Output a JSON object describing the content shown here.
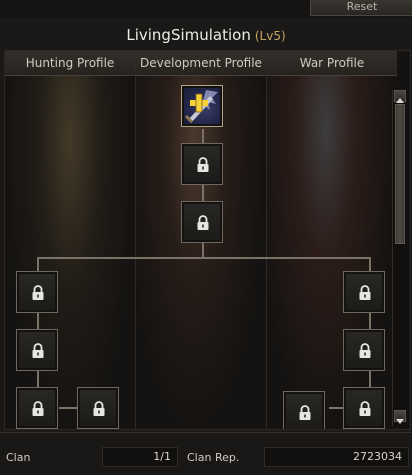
{
  "reset_label": "Reset",
  "title": {
    "name": "LivingSimulation",
    "level": "(Lv5)"
  },
  "columns": [
    "Hunting Profile",
    "Development Profile",
    "War Profile"
  ],
  "footer": {
    "clan_label": "Clan",
    "clan_value": "1/1",
    "rep_label": "Clan Rep.",
    "rep_value": "2723034"
  },
  "colors": {
    "accent": "#c8a468",
    "line": "#7a7266"
  },
  "icons": {
    "active_node": "winged-sword-plus-icon",
    "locked_node": "padlock-icon"
  }
}
